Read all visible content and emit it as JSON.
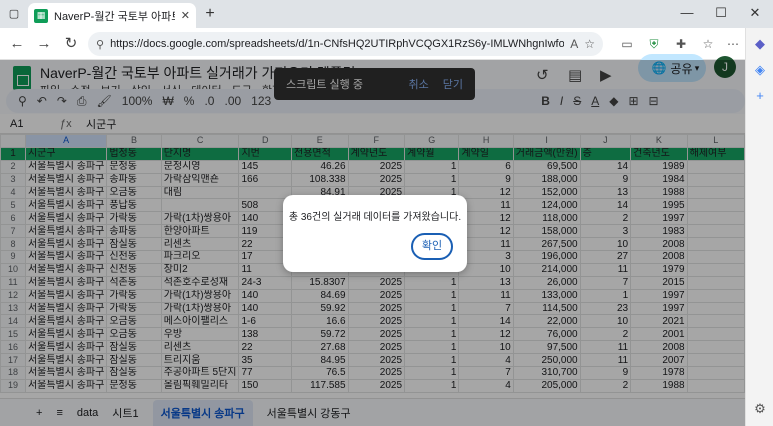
{
  "browser": {
    "tab_title": "NaverP-월간 국토부 아파트 실거래가",
    "url": "https://docs.google.com/spreadsheets/d/1n-CNfsHQ2UTIRphVCQGX1RzS6y-IMLWNhgnIwfo54aQ/edit?gid=1436902382#g..."
  },
  "sheets": {
    "title": "NaverP-월간 국토부 아파트 실거래가 가져오기 템플릿",
    "menu": [
      "파일",
      "수정",
      "보기",
      "삽입",
      "서식",
      "데이터",
      "도구",
      "확장 프로그램"
    ],
    "share_label": "공유",
    "avatar": "J",
    "zoom": "100%",
    "fmt_currency": "₩",
    "fmt_percent": "%",
    "fmt_decimal_dec": ".0",
    "fmt_decimal_inc": ".00",
    "fmt_123": "123",
    "cell_ref": "A1",
    "formula": "시군구"
  },
  "toast": {
    "message": "스크립트 실행 중",
    "cancel": "취소",
    "close": "닫기"
  },
  "columns": [
    "A",
    "B",
    "C",
    "D",
    "E",
    "F",
    "G",
    "H",
    "I",
    "J",
    "K",
    "L"
  ],
  "header_row": [
    "시군구",
    "법정동",
    "단지명",
    "지번",
    "전용면적",
    "계약년도",
    "계약월",
    "계약일",
    "거래금액(만원)",
    "층",
    "건축년도",
    "해제여부"
  ],
  "rows": [
    [
      "서울특별시 송파구",
      "문정동",
      "문정시영",
      "145",
      "46.26",
      "2025",
      "1",
      "6",
      "69,500",
      "14",
      "1989",
      ""
    ],
    [
      "서울특별시 송파구",
      "송파동",
      "가락삼익맨숀",
      "166",
      "108.338",
      "2025",
      "1",
      "9",
      "188,000",
      "9",
      "1984",
      ""
    ],
    [
      "서울특별시 송파구",
      "오금동",
      "대림",
      "",
      "84.91",
      "2025",
      "1",
      "12",
      "152,000",
      "13",
      "1988",
      ""
    ],
    [
      "서울특별시 송파구",
      "풍납동",
      "",
      "508",
      "",
      "",
      "",
      "11",
      "124,000",
      "14",
      "1995",
      ""
    ],
    [
      "서울특별시 송파구",
      "가락동",
      "가락(1차)쌍용아",
      "140",
      "",
      "",
      "",
      "12",
      "118,000",
      "2",
      "1997",
      ""
    ],
    [
      "서울특별시 송파구",
      "송파동",
      "한양아파트",
      "119",
      "",
      "",
      "",
      "12",
      "158,000",
      "3",
      "1983",
      ""
    ],
    [
      "서울특별시 송파구",
      "잠실동",
      "리센츠",
      "22",
      "",
      "",
      "",
      "11",
      "267,500",
      "10",
      "2008",
      ""
    ],
    [
      "서울특별시 송파구",
      "신천동",
      "파크리오",
      "17",
      "",
      "",
      "",
      "3",
      "196,000",
      "27",
      "2008",
      ""
    ],
    [
      "서울특별시 송파구",
      "신천동",
      "장미2",
      "11",
      "",
      "",
      "",
      "10",
      "214,000",
      "11",
      "1979",
      ""
    ],
    [
      "서울특별시 송파구",
      "석촌동",
      "석촌호수로성재",
      "24-3",
      "15.8307",
      "2025",
      "1",
      "13",
      "26,000",
      "7",
      "2015",
      ""
    ],
    [
      "서울특별시 송파구",
      "가락동",
      "가락(1차)쌍용아",
      "140",
      "84.69",
      "2025",
      "1",
      "11",
      "133,000",
      "1",
      "1997",
      ""
    ],
    [
      "서울특별시 송파구",
      "가락동",
      "가락(1차)쌍용아",
      "140",
      "59.92",
      "2025",
      "1",
      "7",
      "114,500",
      "23",
      "1997",
      ""
    ],
    [
      "서울특별시 송파구",
      "오금동",
      "메스아이팰리스",
      "1-6",
      "16.6",
      "2025",
      "1",
      "14",
      "22,000",
      "10",
      "2021",
      ""
    ],
    [
      "서울특별시 송파구",
      "오금동",
      "우방",
      "138",
      "59.72",
      "2025",
      "1",
      "12",
      "76,000",
      "2",
      "2001",
      ""
    ],
    [
      "서울특별시 송파구",
      "잠실동",
      "리센츠",
      "22",
      "27.68",
      "2025",
      "1",
      "10",
      "97,500",
      "11",
      "2008",
      ""
    ],
    [
      "서울특별시 송파구",
      "잠실동",
      "트리지움",
      "35",
      "84.95",
      "2025",
      "1",
      "4",
      "250,000",
      "11",
      "2007",
      ""
    ],
    [
      "서울특별시 송파구",
      "잠실동",
      "주공아파트 5단지",
      "77",
      "76.5",
      "2025",
      "1",
      "7",
      "310,700",
      "9",
      "1978",
      ""
    ],
    [
      "서울특별시 송파구",
      "문정동",
      "올림픽훼밀리타",
      "150",
      "117.585",
      "2025",
      "1",
      "4",
      "205,000",
      "2",
      "1988",
      ""
    ]
  ],
  "sheet_tabs": [
    "data",
    "시트1",
    "서울특별시 송파구",
    "서울특별시 강동구"
  ],
  "dialog": {
    "message": "총 36건의 실거래 데이터를 가져왔습니다.",
    "ok": "확인"
  }
}
